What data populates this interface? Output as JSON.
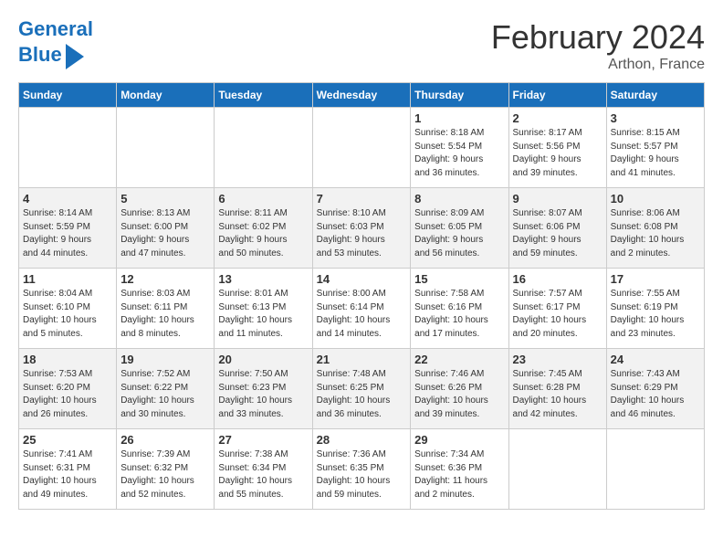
{
  "header": {
    "logo_line1": "General",
    "logo_line2": "Blue",
    "month": "February 2024",
    "location": "Arthon, France"
  },
  "weekdays": [
    "Sunday",
    "Monday",
    "Tuesday",
    "Wednesday",
    "Thursday",
    "Friday",
    "Saturday"
  ],
  "weeks": [
    [
      {
        "day": "",
        "info": ""
      },
      {
        "day": "",
        "info": ""
      },
      {
        "day": "",
        "info": ""
      },
      {
        "day": "",
        "info": ""
      },
      {
        "day": "1",
        "info": "Sunrise: 8:18 AM\nSunset: 5:54 PM\nDaylight: 9 hours\nand 36 minutes."
      },
      {
        "day": "2",
        "info": "Sunrise: 8:17 AM\nSunset: 5:56 PM\nDaylight: 9 hours\nand 39 minutes."
      },
      {
        "day": "3",
        "info": "Sunrise: 8:15 AM\nSunset: 5:57 PM\nDaylight: 9 hours\nand 41 minutes."
      }
    ],
    [
      {
        "day": "4",
        "info": "Sunrise: 8:14 AM\nSunset: 5:59 PM\nDaylight: 9 hours\nand 44 minutes."
      },
      {
        "day": "5",
        "info": "Sunrise: 8:13 AM\nSunset: 6:00 PM\nDaylight: 9 hours\nand 47 minutes."
      },
      {
        "day": "6",
        "info": "Sunrise: 8:11 AM\nSunset: 6:02 PM\nDaylight: 9 hours\nand 50 minutes."
      },
      {
        "day": "7",
        "info": "Sunrise: 8:10 AM\nSunset: 6:03 PM\nDaylight: 9 hours\nand 53 minutes."
      },
      {
        "day": "8",
        "info": "Sunrise: 8:09 AM\nSunset: 6:05 PM\nDaylight: 9 hours\nand 56 minutes."
      },
      {
        "day": "9",
        "info": "Sunrise: 8:07 AM\nSunset: 6:06 PM\nDaylight: 9 hours\nand 59 minutes."
      },
      {
        "day": "10",
        "info": "Sunrise: 8:06 AM\nSunset: 6:08 PM\nDaylight: 10 hours\nand 2 minutes."
      }
    ],
    [
      {
        "day": "11",
        "info": "Sunrise: 8:04 AM\nSunset: 6:10 PM\nDaylight: 10 hours\nand 5 minutes."
      },
      {
        "day": "12",
        "info": "Sunrise: 8:03 AM\nSunset: 6:11 PM\nDaylight: 10 hours\nand 8 minutes."
      },
      {
        "day": "13",
        "info": "Sunrise: 8:01 AM\nSunset: 6:13 PM\nDaylight: 10 hours\nand 11 minutes."
      },
      {
        "day": "14",
        "info": "Sunrise: 8:00 AM\nSunset: 6:14 PM\nDaylight: 10 hours\nand 14 minutes."
      },
      {
        "day": "15",
        "info": "Sunrise: 7:58 AM\nSunset: 6:16 PM\nDaylight: 10 hours\nand 17 minutes."
      },
      {
        "day": "16",
        "info": "Sunrise: 7:57 AM\nSunset: 6:17 PM\nDaylight: 10 hours\nand 20 minutes."
      },
      {
        "day": "17",
        "info": "Sunrise: 7:55 AM\nSunset: 6:19 PM\nDaylight: 10 hours\nand 23 minutes."
      }
    ],
    [
      {
        "day": "18",
        "info": "Sunrise: 7:53 AM\nSunset: 6:20 PM\nDaylight: 10 hours\nand 26 minutes."
      },
      {
        "day": "19",
        "info": "Sunrise: 7:52 AM\nSunset: 6:22 PM\nDaylight: 10 hours\nand 30 minutes."
      },
      {
        "day": "20",
        "info": "Sunrise: 7:50 AM\nSunset: 6:23 PM\nDaylight: 10 hours\nand 33 minutes."
      },
      {
        "day": "21",
        "info": "Sunrise: 7:48 AM\nSunset: 6:25 PM\nDaylight: 10 hours\nand 36 minutes."
      },
      {
        "day": "22",
        "info": "Sunrise: 7:46 AM\nSunset: 6:26 PM\nDaylight: 10 hours\nand 39 minutes."
      },
      {
        "day": "23",
        "info": "Sunrise: 7:45 AM\nSunset: 6:28 PM\nDaylight: 10 hours\nand 42 minutes."
      },
      {
        "day": "24",
        "info": "Sunrise: 7:43 AM\nSunset: 6:29 PM\nDaylight: 10 hours\nand 46 minutes."
      }
    ],
    [
      {
        "day": "25",
        "info": "Sunrise: 7:41 AM\nSunset: 6:31 PM\nDaylight: 10 hours\nand 49 minutes."
      },
      {
        "day": "26",
        "info": "Sunrise: 7:39 AM\nSunset: 6:32 PM\nDaylight: 10 hours\nand 52 minutes."
      },
      {
        "day": "27",
        "info": "Sunrise: 7:38 AM\nSunset: 6:34 PM\nDaylight: 10 hours\nand 55 minutes."
      },
      {
        "day": "28",
        "info": "Sunrise: 7:36 AM\nSunset: 6:35 PM\nDaylight: 10 hours\nand 59 minutes."
      },
      {
        "day": "29",
        "info": "Sunrise: 7:34 AM\nSunset: 6:36 PM\nDaylight: 11 hours\nand 2 minutes."
      },
      {
        "day": "",
        "info": ""
      },
      {
        "day": "",
        "info": ""
      }
    ]
  ]
}
